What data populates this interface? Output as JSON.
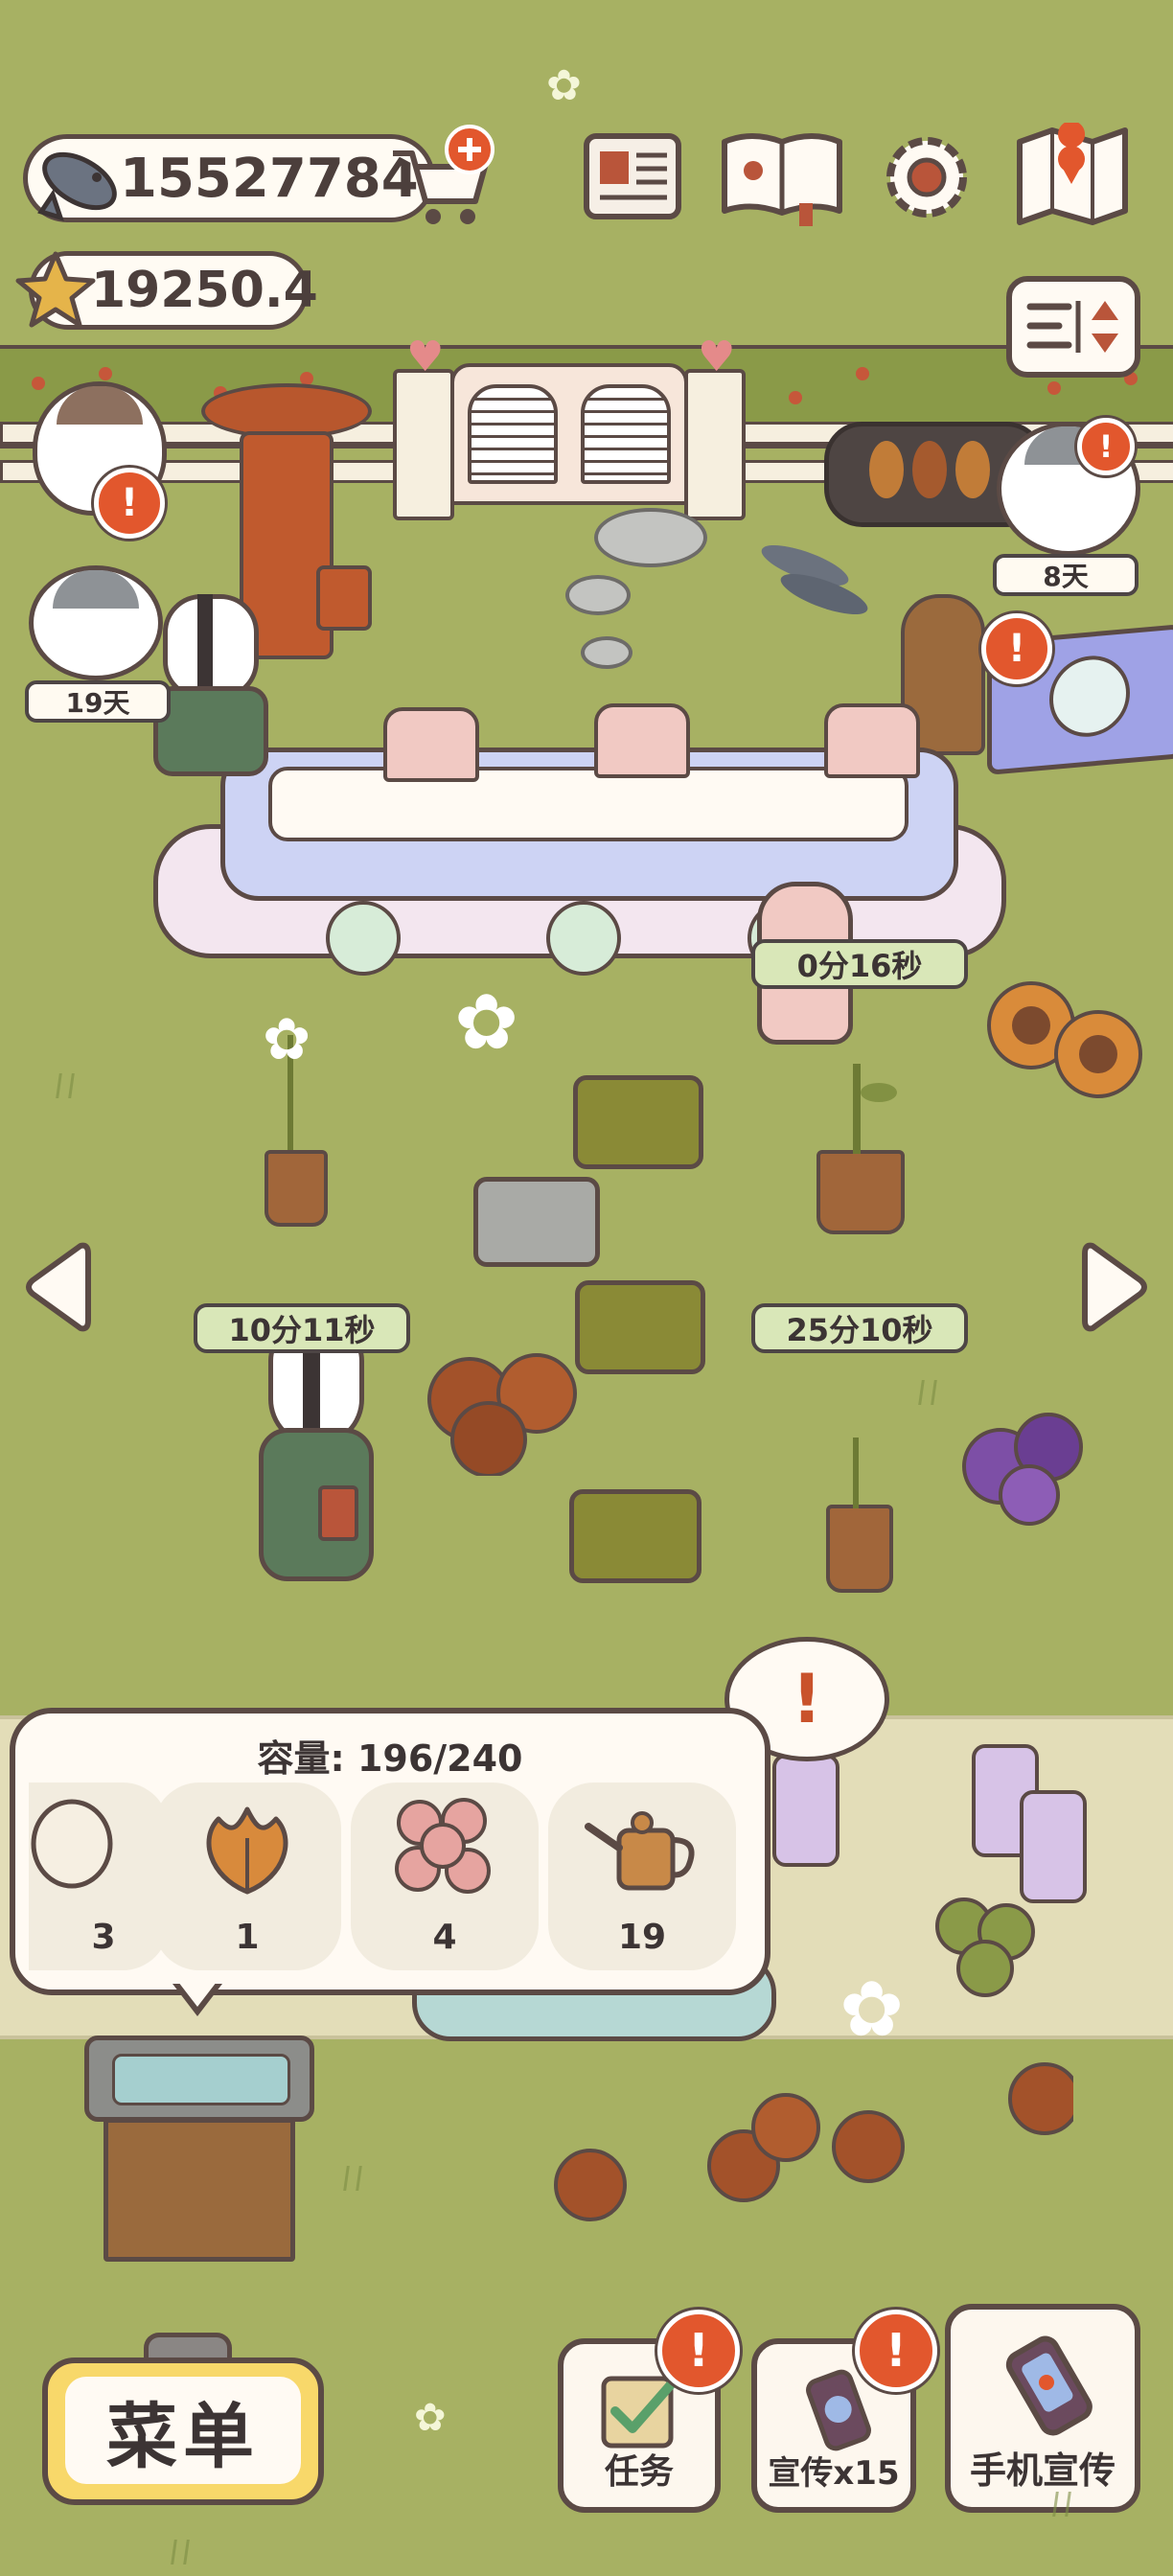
{
  "currency": {
    "fish": "15527784",
    "stars": "19250.4"
  },
  "top_icons": [
    "newspaper-icon",
    "photo-album-icon",
    "settings-gear-icon",
    "map-icon"
  ],
  "timers": {
    "dining_table": "0分16秒",
    "plant_left": "10分11秒",
    "plant_right": "25分10秒"
  },
  "cat_days": {
    "cat_left": "19天",
    "cat_right": "8天"
  },
  "storage": {
    "capacity_label": "容量: 196/240",
    "items": [
      {
        "icon": "egg-icon",
        "count": "3"
      },
      {
        "icon": "orange-leaf-icon",
        "count": "1"
      },
      {
        "icon": "pink-flower-bundle-icon",
        "count": "4"
      },
      {
        "icon": "watering-can-icon",
        "count": "19"
      }
    ]
  },
  "buttons": {
    "menu": "菜单",
    "tasks": "任务",
    "promote": "宣传x15",
    "phone_promote": "手机宣传"
  },
  "colors": {
    "grass": "#a7b163",
    "path": "#e3ddb8",
    "alert": "#e2572d",
    "timer_bg": "#d9e7b8",
    "menu_yellow": "#f8d86a"
  }
}
